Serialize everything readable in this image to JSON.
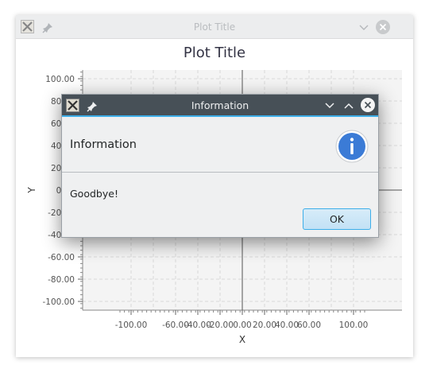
{
  "main_window": {
    "title": "Plot Title",
    "app_icon": "x-app-icon",
    "buttons": [
      "pin-icon",
      "minimize-icon",
      "close-icon"
    ]
  },
  "chart_data": {
    "type": "scatter",
    "title": "Plot Title",
    "xlabel": "X",
    "ylabel": "Y",
    "xlim": [
      -110,
      110
    ],
    "ylim": [
      -110,
      110
    ],
    "x_ticks": [
      -100,
      -60,
      -40,
      -20,
      0,
      20,
      40,
      60,
      100
    ],
    "x_tick_labels": [
      "-100.00",
      "-60.00",
      "-40.00",
      "-20.00",
      "0.00",
      "20.00",
      "40.00",
      "60.00",
      "100.00"
    ],
    "y_ticks": [
      100,
      80,
      60,
      40,
      20,
      0,
      -20,
      -40,
      -60,
      -80,
      -100
    ],
    "y_tick_labels": [
      "100.00",
      "80.00",
      "60.00",
      "40.00",
      "20.00",
      "0.00",
      "-20.00",
      "-40.00",
      "-60.00",
      "-80.00",
      "-100.00"
    ],
    "grid": true,
    "series": []
  },
  "dialog": {
    "title": "Information",
    "header": "Information",
    "message": "Goodbye!",
    "ok_label": "OK",
    "accent_color": "#3daee9",
    "icon": "info-icon"
  },
  "colors": {
    "dialog_titlebar": "#475057",
    "info_icon": "#3b7bd6"
  }
}
